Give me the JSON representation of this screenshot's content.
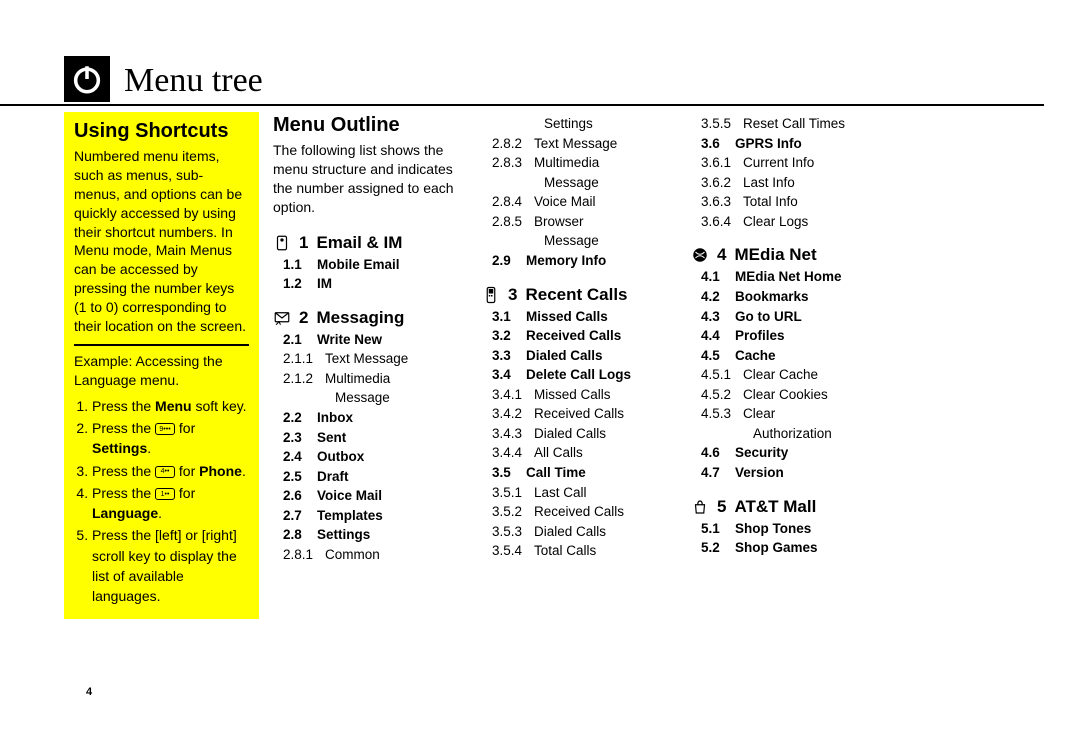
{
  "page_number": "4",
  "title": "Menu tree",
  "using_shortcuts": {
    "heading": "Using Shortcuts",
    "body": "Numbered menu items, such as menus, sub-menus, and options can be quickly accessed by using their shortcut numbers. In Menu mode, Main Menus can be accessed by pressing the number keys (1 to 0) corresponding to their location on the screen.",
    "example": "Example: Accessing the Language menu.",
    "steps": {
      "s1a": "Press the ",
      "s1b": "Menu",
      "s1c": " soft key.",
      "s2a": "Press the ",
      "s2b": " for ",
      "s2c": "Settings",
      "s2d": ".",
      "s3a": "Press the ",
      "s3b": " for ",
      "s3c": "Phone",
      "s3d": ".",
      "s4a": "Press the ",
      "s4b": " for ",
      "s4c": "Language",
      "s4d": ".",
      "s5": "Press the [left] or [right] scroll key to display the list of available languages."
    }
  },
  "menu_outline_heading": "Menu Outline",
  "menu_outline_intro": "The following list shows the menu structure and indicates the number assigned to each option.",
  "section1": {
    "num": "1",
    "label": "Email & IM"
  },
  "s1": {
    "r0": {
      "num": "1.1",
      "lbl": "Mobile Email"
    },
    "r1": {
      "num": "1.2",
      "lbl": "IM"
    }
  },
  "section2": {
    "num": "2",
    "label": "Messaging"
  },
  "s2": {
    "r0": {
      "num": "2.1",
      "lbl": "Write New"
    },
    "r1": {
      "num": "2.1.1",
      "lbl": "Text Message"
    },
    "r2": {
      "num": "2.1.2",
      "lbl": "Multimedia"
    },
    "r2b": {
      "lbl": "Message"
    },
    "r3": {
      "num": "2.2",
      "lbl": "Inbox"
    },
    "r4": {
      "num": "2.3",
      "lbl": "Sent"
    },
    "r5": {
      "num": "2.4",
      "lbl": "Outbox"
    },
    "r6": {
      "num": "2.5",
      "lbl": "Draft"
    },
    "r7": {
      "num": "2.6",
      "lbl": "Voice Mail"
    },
    "r8": {
      "num": "2.7",
      "lbl": "Templates"
    },
    "r9": {
      "num": "2.8",
      "lbl": "Settings"
    },
    "r10": {
      "num": "2.8.1",
      "lbl": "Common"
    }
  },
  "col3": {
    "r0": {
      "lbl": "Settings"
    },
    "r1": {
      "num": "2.8.2",
      "lbl": "Text Message"
    },
    "r2": {
      "num": "2.8.3",
      "lbl": "Multimedia"
    },
    "r2b": {
      "lbl": "Message"
    },
    "r3": {
      "num": "2.8.4",
      "lbl": "Voice Mail"
    },
    "r4": {
      "num": "2.8.5",
      "lbl": "Browser"
    },
    "r4b": {
      "lbl": "Message"
    },
    "r5": {
      "num": "2.9",
      "lbl": "Memory Info"
    }
  },
  "section3": {
    "num": "3",
    "label": "Recent Calls"
  },
  "s3": {
    "r0": {
      "num": "3.1",
      "lbl": "Missed Calls"
    },
    "r1": {
      "num": "3.2",
      "lbl": "Received Calls"
    },
    "r2": {
      "num": "3.3",
      "lbl": "Dialed Calls"
    },
    "r3": {
      "num": "3.4",
      "lbl": "Delete Call Logs"
    },
    "r4": {
      "num": "3.4.1",
      "lbl": "Missed Calls"
    },
    "r5": {
      "num": "3.4.2",
      "lbl": "Received Calls"
    },
    "r6": {
      "num": "3.4.3",
      "lbl": "Dialed Calls"
    },
    "r7": {
      "num": "3.4.4",
      "lbl": "All Calls"
    },
    "r8": {
      "num": "3.5",
      "lbl": "Call Time"
    },
    "r9": {
      "num": "3.5.1",
      "lbl": "Last Call"
    },
    "r10": {
      "num": "3.5.2",
      "lbl": "Received Calls"
    },
    "r11": {
      "num": "3.5.3",
      "lbl": "Dialed Calls"
    },
    "r12": {
      "num": "3.5.4",
      "lbl": "Total Calls"
    }
  },
  "col4": {
    "r0": {
      "num": "3.5.5",
      "lbl": "Reset Call Times"
    },
    "r1": {
      "num": "3.6",
      "lbl": "GPRS Info"
    },
    "r2": {
      "num": "3.6.1",
      "lbl": "Current Info"
    },
    "r3": {
      "num": "3.6.2",
      "lbl": "Last Info"
    },
    "r4": {
      "num": "3.6.3",
      "lbl": "Total Info"
    },
    "r5": {
      "num": "3.6.4",
      "lbl": "Clear Logs"
    }
  },
  "section4": {
    "num": "4",
    "label": "MEdia Net"
  },
  "s4": {
    "r0": {
      "num": "4.1",
      "lbl": "MEdia Net Home"
    },
    "r1": {
      "num": "4.2",
      "lbl": "Bookmarks"
    },
    "r2": {
      "num": "4.3",
      "lbl": "Go to URL"
    },
    "r3": {
      "num": "4.4",
      "lbl": "Profiles"
    },
    "r4": {
      "num": "4.5",
      "lbl": "Cache"
    },
    "r5": {
      "num": "4.5.1",
      "lbl": "Clear Cache"
    },
    "r6": {
      "num": "4.5.2",
      "lbl": "Clear Cookies"
    },
    "r7": {
      "num": "4.5.3",
      "lbl": "Clear"
    },
    "r7b": {
      "lbl": "Authorization"
    },
    "r8": {
      "num": "4.6",
      "lbl": "Security"
    },
    "r9": {
      "num": "4.7",
      "lbl": "Version"
    }
  },
  "section5": {
    "num": "5",
    "label": "AT&T Mall"
  },
  "s5": {
    "r0": {
      "num": "5.1",
      "lbl": "Shop Tones"
    },
    "r1": {
      "num": "5.2",
      "lbl": "Shop Games"
    }
  }
}
